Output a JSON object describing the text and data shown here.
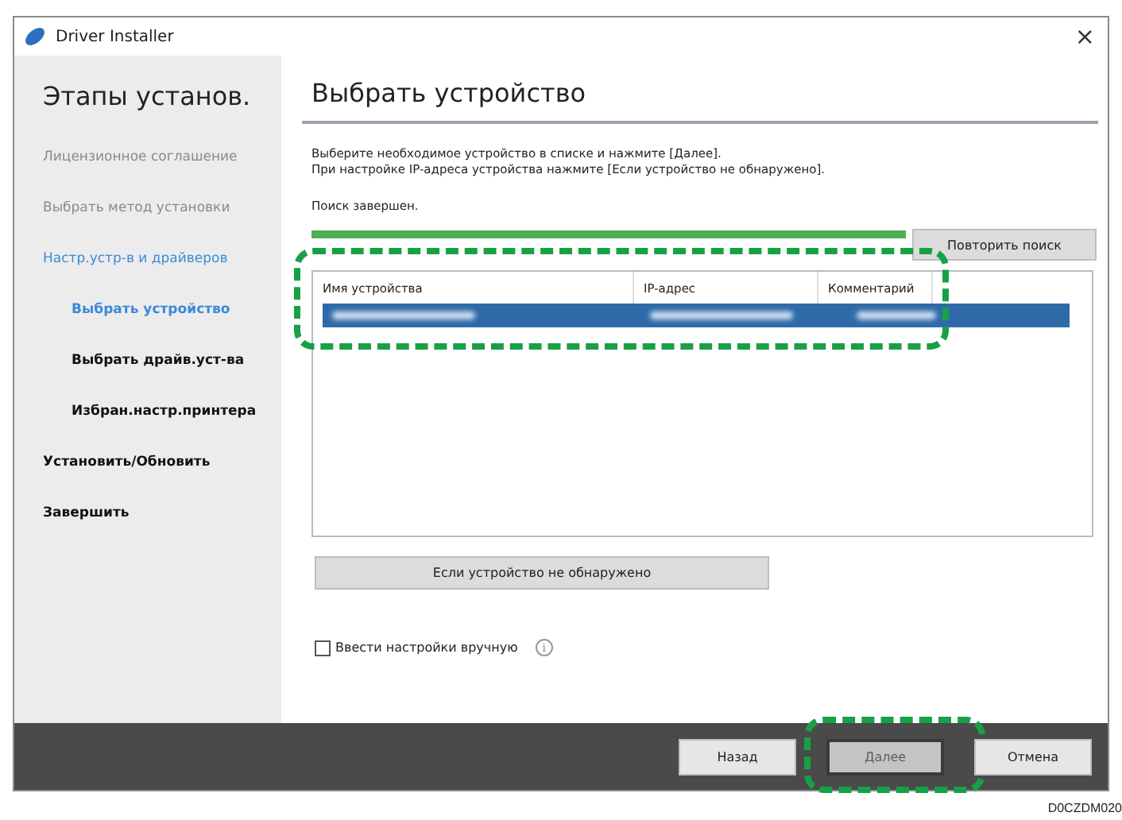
{
  "window": {
    "title": "Driver Installer",
    "close": "×"
  },
  "sidebar": {
    "title": "Этапы установ.",
    "steps": [
      {
        "label": "Лицензионное соглашение",
        "kind": "done"
      },
      {
        "label": "Выбрать метод установки",
        "kind": "done"
      },
      {
        "label": "Настр.устр-в и драйверов",
        "kind": "active",
        "children": [
          {
            "label": "Выбрать устройство",
            "kind": "current"
          },
          {
            "label": "Выбрать драйв.уст-ва",
            "kind": "pending"
          },
          {
            "label": "Избран.настр.принтера",
            "kind": "pending"
          }
        ]
      },
      {
        "label": "Установить/Обновить",
        "kind": "pending"
      },
      {
        "label": "Завершить",
        "kind": "pending"
      }
    ]
  },
  "content": {
    "heading": "Выбрать устройство",
    "instructions": [
      "Выберите необходимое устройство в списке и нажмите [Далее].",
      "При настройке IP-адреса устройства нажмите [Если устройство не обнаружено]."
    ],
    "search_status": "Поиск завершен.",
    "progress": {
      "level": 1
    },
    "retry_button": "Повторить поиск",
    "table": {
      "columns": [
        "Имя устройства",
        "IP-адрес",
        "Комментарий"
      ],
      "rows": [
        {
          "selected": true
        }
      ]
    },
    "not_found_button": "Если устройство не обнаружено",
    "manual_checkbox": {
      "label": "Ввести настройки вручную",
      "checked": false,
      "info": "i"
    }
  },
  "footer": {
    "buttons": [
      {
        "label": "Назад",
        "disabled": false,
        "highlighted": false
      },
      {
        "label": "Далее",
        "disabled": true,
        "highlighted": true
      },
      {
        "label": "Отмена",
        "disabled": false,
        "highlighted": false
      }
    ]
  },
  "table_highlighted": true,
  "caption": "D0CZDM020"
}
